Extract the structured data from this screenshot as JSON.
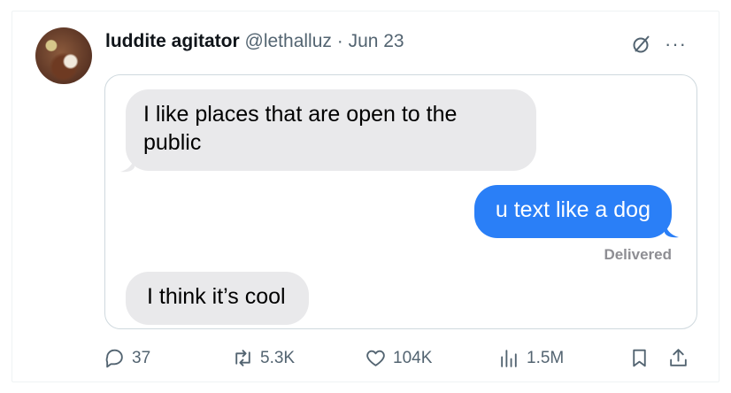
{
  "tweet": {
    "author_name": "luddite agitator",
    "handle": "@lethalluz",
    "separator": " · ",
    "date": "Jun 23",
    "more_label": "···"
  },
  "screenshot": {
    "messages": [
      {
        "side": "received",
        "text": "I like places that are open to the public"
      },
      {
        "side": "sent",
        "text": "u text like a dog"
      },
      {
        "side": "received",
        "text": "I think it’s cool"
      }
    ],
    "delivered_label": "Delivered",
    "colors": {
      "received": "#e9e9eb",
      "sent": "#2a7ff7"
    }
  },
  "actions": {
    "replies": "37",
    "reposts": "5.3K",
    "likes": "104K",
    "views": "1.5M"
  },
  "icons": [
    "grok-icon",
    "more-icon",
    "reply-icon",
    "repost-icon",
    "like-icon",
    "views-icon",
    "bookmark-icon",
    "share-icon"
  ]
}
